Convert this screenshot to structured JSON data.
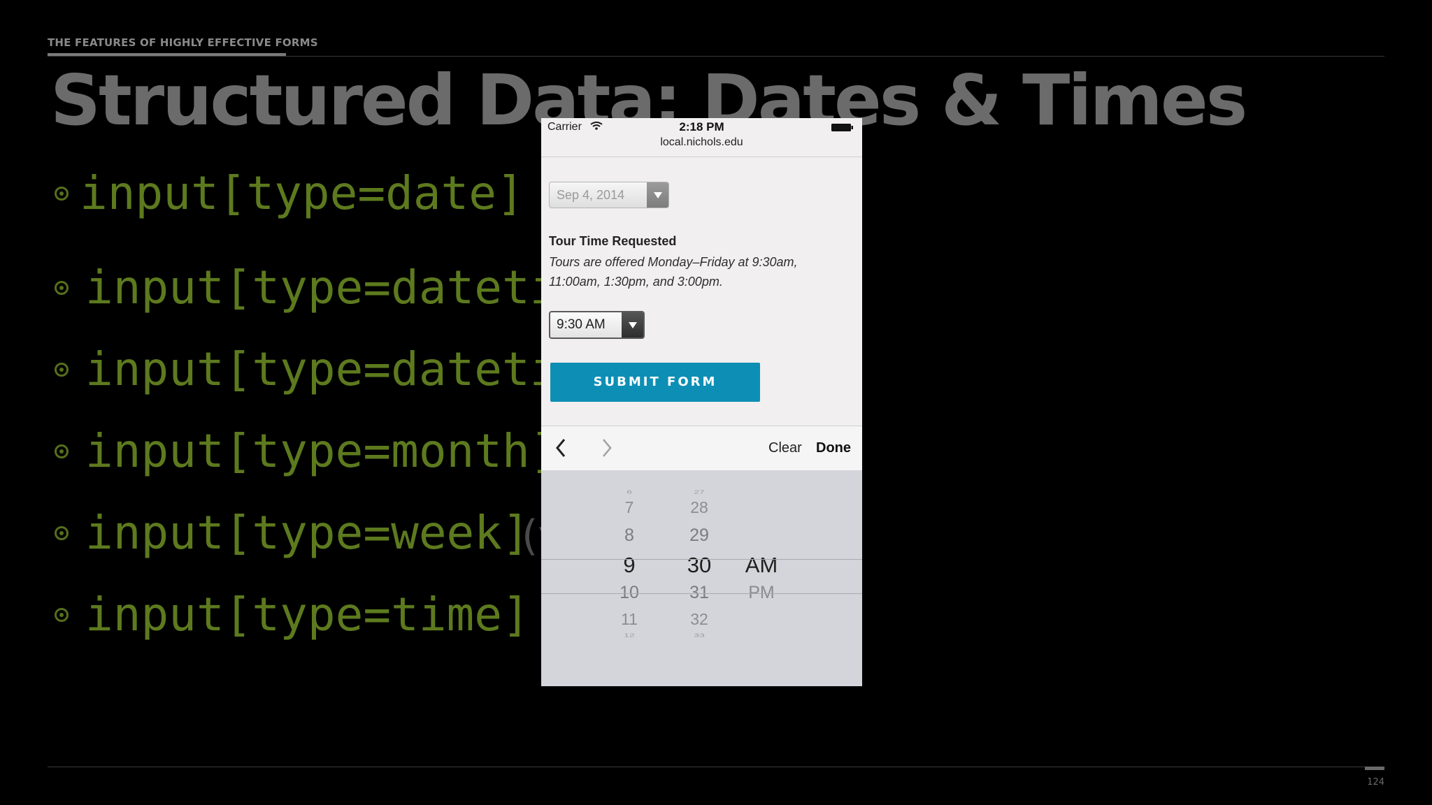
{
  "slide": {
    "kicker": "THE FEATURES OF HIGHLY EFFECTIVE FORMS",
    "title": "Structured Data: Dates & Times",
    "bullets": [
      {
        "code": "input[type=date]",
        "note": ""
      },
      {
        "code": "input[type=datetim",
        "note": ""
      },
      {
        "code": "input[type=datetim",
        "note": ")"
      },
      {
        "code": "input[type=month]",
        "note": ""
      },
      {
        "code": "input[type=week]",
        "note": "(y"
      },
      {
        "code": "input[type=time]",
        "note": ""
      }
    ],
    "page_number": "124"
  },
  "phone": {
    "status": {
      "carrier": "Carrier",
      "time": "2:18 PM"
    },
    "url": "local.nichols.edu",
    "date_field": {
      "value": "Sep 4, 2014"
    },
    "tour": {
      "label": "Tour Time Requested",
      "hint": "Tours are offered Monday–Friday at 9:30am, 11:00am, 1:30pm, and 3:00pm."
    },
    "time_field": {
      "value": "9:30 AM"
    },
    "submit_label": "SUBMIT FORM",
    "picker": {
      "clear_label": "Clear",
      "done_label": "Done",
      "hours": [
        "6",
        "7",
        "8",
        "9",
        "10",
        "11",
        "12"
      ],
      "minutes": [
        "27",
        "28",
        "29",
        "30",
        "31",
        "32",
        "33"
      ],
      "meridiem": [
        "AM",
        "PM"
      ],
      "selected": {
        "hour": "9",
        "minute": "30",
        "meridiem": "AM"
      }
    }
  },
  "colors": {
    "background": "#000000",
    "title": "#6b6b6b",
    "code": "#5d7a1e",
    "submit": "#0d8fb5"
  }
}
